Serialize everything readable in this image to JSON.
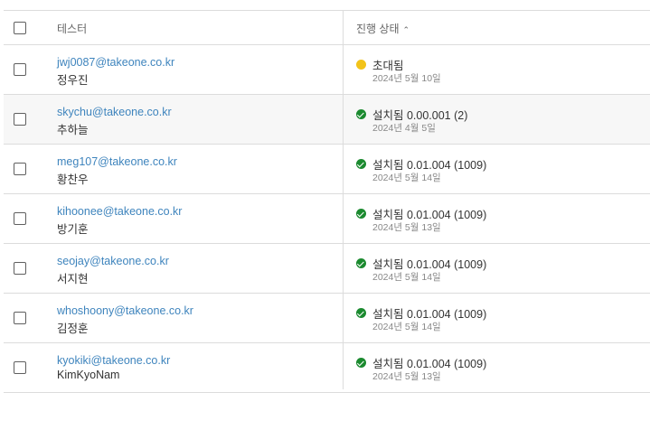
{
  "header": {
    "tester": "테스터",
    "status": "진행 상태",
    "sort_icon": "chevron-up-icon"
  },
  "colors": {
    "link": "#3e84bd",
    "installed": "#1b8a2f",
    "invited": "#f2c31a"
  },
  "rows": [
    {
      "email": "jwj0087@takeone.co.kr",
      "name": "정우진",
      "status": "초대됨",
      "status_type": "invited",
      "date": "2024년 5월 10일"
    },
    {
      "email": "skychu@takeone.co.kr",
      "name": "추하늘",
      "status": "설치됨 0.00.001 (2)",
      "status_type": "installed",
      "date": "2024년 4월 5일"
    },
    {
      "email": "meg107@takeone.co.kr",
      "name": "황찬우",
      "status": "설치됨 0.01.004 (1009)",
      "status_type": "installed",
      "date": "2024년 5월 14일"
    },
    {
      "email": "kihoonee@takeone.co.kr",
      "name": "방기훈",
      "status": "설치됨 0.01.004 (1009)",
      "status_type": "installed",
      "date": "2024년 5월 13일"
    },
    {
      "email": "seojay@takeone.co.kr",
      "name": "서지현",
      "status": "설치됨 0.01.004 (1009)",
      "status_type": "installed",
      "date": "2024년 5월 14일"
    },
    {
      "email": "whoshoony@takeone.co.kr",
      "name": "김정훈",
      "status": "설치됨 0.01.004 (1009)",
      "status_type": "installed",
      "date": "2024년 5월 14일"
    },
    {
      "email": "kyokiki@takeone.co.kr",
      "name": "KimKyoNam",
      "status": "설치됨 0.01.004 (1009)",
      "status_type": "installed",
      "date": "2024년 5월 13일"
    }
  ]
}
